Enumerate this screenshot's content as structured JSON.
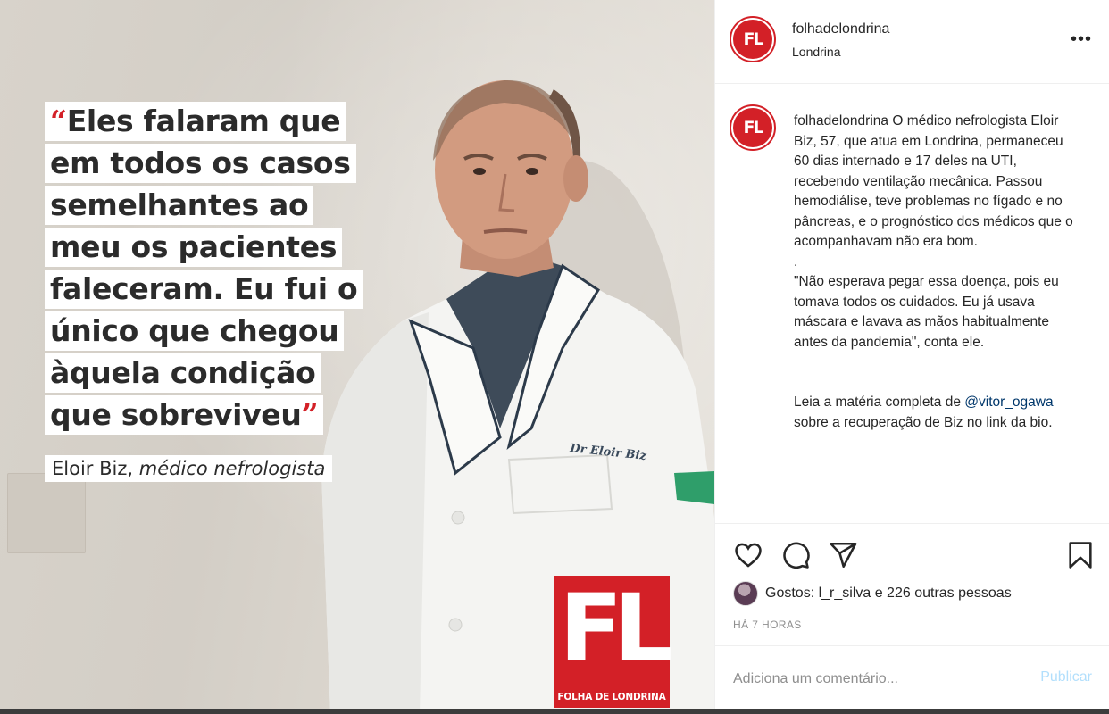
{
  "post": {
    "quote_open": "“",
    "quote_close": "”",
    "quote_lines": [
      "Eles falaram que",
      "em todos os casos",
      "semelhantes ao",
      "meu os pacientes",
      "faleceram. Eu fui o",
      "único que chegou",
      "àquela condição",
      "que sobreviveu"
    ],
    "attribution_name": "Eloir Biz,",
    "attribution_role": "médico nefrologista",
    "coat_name": "Dr Eloir Biz",
    "logo_letters": "FL",
    "logo_caption": "FOLHA DE LONDRINA"
  },
  "header": {
    "avatar_text": "FL",
    "username": "folhadelondrina",
    "location": "Londrina",
    "more_icon": "ellipsis-icon"
  },
  "caption": {
    "username": "folhadelondrina",
    "text_1": "O médico nefrologista Eloir Biz, 57, que atua em Londrina, permaneceu 60 dias internado e 17 deles na UTI, recebendo ventilação mecânica. Passou hemodiálise, teve problemas no fígado e no pâncreas, e o prognóstico dos médicos que o acompanhavam não era bom.",
    "separator": ".",
    "text_2": "\"Não esperava pegar essa doença, pois eu tomava todos os cuidados. Eu já usava máscara e lavava as mãos habitualmente antes da pandemia\", conta ele.",
    "text_3_prefix": "Leia a matéria completa de",
    "mention": "@vitor_ogawa",
    "text_3_suffix": "sobre a recuperação de Biz no link da bio."
  },
  "actions": {
    "icons": [
      "heart-icon",
      "comment-icon",
      "share-icon",
      "bookmark-icon"
    ],
    "likes_text": "Gostos: l_r_silva e 226 outras pessoas",
    "timestamp": "HÁ 7 HORAS"
  },
  "comment_box": {
    "placeholder": "Adiciona um comentário...",
    "publish_label": "Publicar"
  },
  "colors": {
    "brand_red": "#d32027",
    "publish_disabled": "#b2dffc",
    "mention": "#00376b"
  }
}
